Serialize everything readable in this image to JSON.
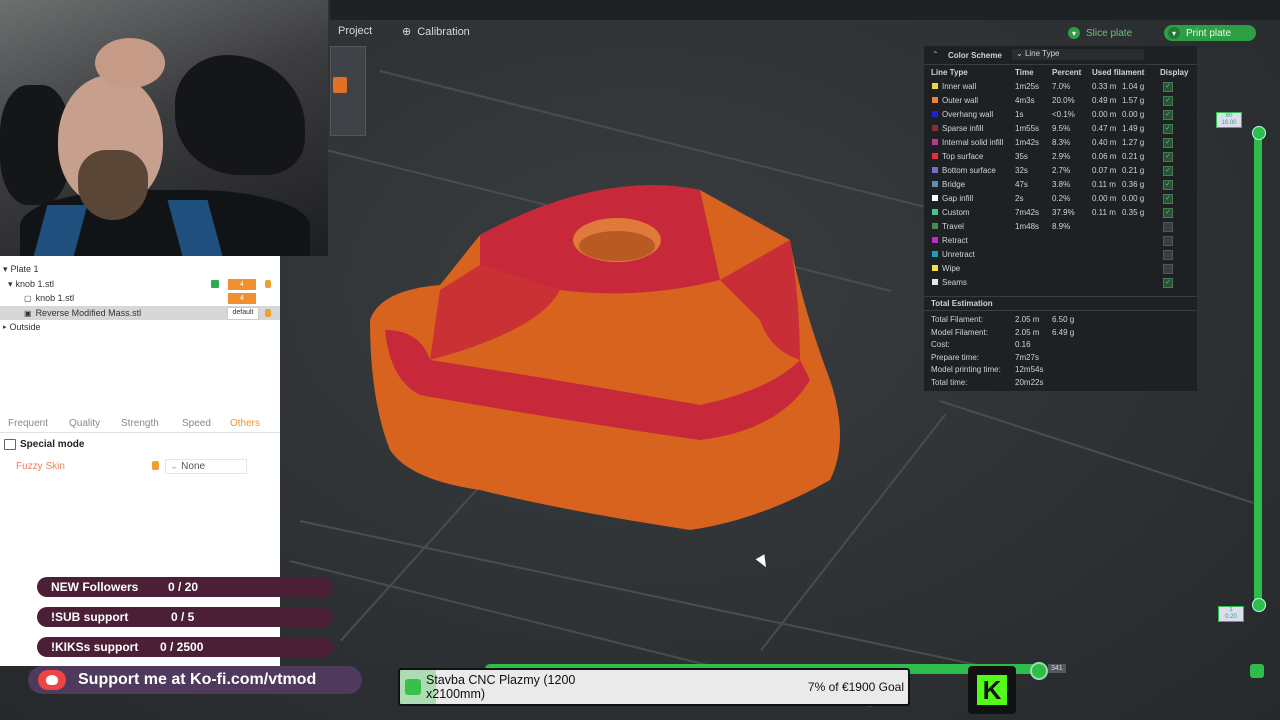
{
  "toolbar": {
    "project": "Project",
    "calibration": "Calibration",
    "slice_plate": "Slice plate",
    "print_plate": "Print plate"
  },
  "objects": {
    "plate": "Plate 1",
    "knob_group": "knob 1.stl",
    "knob_group_tag": "4",
    "knob_part": "knob 1.stl",
    "knob_part_tag": "4",
    "modifier": "Reverse Modified Mass.stl",
    "modifier_tag": "default",
    "outside": "Outside"
  },
  "settings": {
    "tabs": [
      "Frequent",
      "Quality",
      "Strength",
      "Speed",
      "Others"
    ],
    "active_tab": "Others",
    "section": "Special mode",
    "fuzzy_skin_label": "Fuzzy Skin",
    "fuzzy_skin_value": "None"
  },
  "legend": {
    "color_scheme_label": "Color Scheme",
    "color_scheme_value": "Line Type",
    "headers": [
      "Line Type",
      "Time",
      "Percent",
      "Used filament",
      "Display"
    ],
    "rows": [
      {
        "name": "Inner wall",
        "time": "1m25s",
        "percent": "7.0%",
        "len": "0.33 m",
        "weight": "1.04 g",
        "color": "#f0d23a",
        "display": true
      },
      {
        "name": "Outer wall",
        "time": "4m3s",
        "percent": "20.0%",
        "len": "0.49 m",
        "weight": "1.57 g",
        "color": "#f08030",
        "display": true
      },
      {
        "name": "Overhang wall",
        "time": "1s",
        "percent": "<0.1%",
        "len": "0.00 m",
        "weight": "0.00 g",
        "color": "#1f1fd6",
        "display": true
      },
      {
        "name": "Sparse infill",
        "time": "1m55s",
        "percent": "9.5%",
        "len": "0.47 m",
        "weight": "1.49 g",
        "color": "#8a2b3a",
        "display": true
      },
      {
        "name": "Internal solid infill",
        "time": "1m42s",
        "percent": "8.3%",
        "len": "0.40 m",
        "weight": "1.27 g",
        "color": "#b8388f",
        "display": true
      },
      {
        "name": "Top surface",
        "time": "35s",
        "percent": "2.9%",
        "len": "0.06 m",
        "weight": "0.21 g",
        "color": "#e0303a",
        "display": true
      },
      {
        "name": "Bottom surface",
        "time": "32s",
        "percent": "2.7%",
        "len": "0.07 m",
        "weight": "0.21 g",
        "color": "#7a6ad0",
        "display": true
      },
      {
        "name": "Bridge",
        "time": "47s",
        "percent": "3.8%",
        "len": "0.11 m",
        "weight": "0.36 g",
        "color": "#5a8fb0",
        "display": true
      },
      {
        "name": "Gap infill",
        "time": "2s",
        "percent": "0.2%",
        "len": "0.00 m",
        "weight": "0.00 g",
        "color": "#ffffff",
        "display": true
      },
      {
        "name": "Custom",
        "time": "7m42s",
        "percent": "37.9%",
        "len": "0.11 m",
        "weight": "0.35 g",
        "color": "#4ec08a",
        "display": true
      },
      {
        "name": "Travel",
        "time": "1m48s",
        "percent": "8.9%",
        "len": "",
        "weight": "",
        "color": "#4d8a4d",
        "display": false
      },
      {
        "name": "Retract",
        "time": "",
        "percent": "",
        "len": "",
        "weight": "",
        "color": "#c02bd0",
        "display": false
      },
      {
        "name": "Unretract",
        "time": "",
        "percent": "",
        "len": "",
        "weight": "",
        "color": "#1aa0b0",
        "display": false
      },
      {
        "name": "Wipe",
        "time": "",
        "percent": "",
        "len": "",
        "weight": "",
        "color": "#f0e040",
        "display": false
      },
      {
        "name": "Seams",
        "time": "",
        "percent": "",
        "len": "",
        "weight": "",
        "color": "#e8e8e8",
        "display": true
      }
    ],
    "estimation_title": "Total Estimation",
    "estimation": [
      {
        "label": "Total Filament:",
        "v1": "2.05 m",
        "v2": "6.50 g"
      },
      {
        "label": "Model Filament:",
        "v1": "2.05 m",
        "v2": "6.49 g"
      },
      {
        "label": "Cost:",
        "v1": "0.16",
        "v2": ""
      },
      {
        "label": "Prepare time:",
        "v1": "7m27s",
        "v2": ""
      },
      {
        "label": "Model printing time:",
        "v1": "12m54s",
        "v2": ""
      },
      {
        "label": "Total time:",
        "v1": "20m22s",
        "v2": ""
      }
    ]
  },
  "slider": {
    "top_label_a": "80",
    "top_label_b": "16.00",
    "bottom_label_a": "1",
    "bottom_label_b": "0.20",
    "horizontal_label": "341"
  },
  "stream": {
    "goals": [
      {
        "label": "NEW Followers",
        "count": "0 / 20"
      },
      {
        "label": "!SUB support",
        "count": "0 / 5"
      },
      {
        "label": "!KIKSs support",
        "count": "0 / 2500"
      }
    ],
    "kofi": "Support me at Ko-fi.com/vtmod",
    "donation_title": "Stavba CNC Plazmy (1200 x2100mm)",
    "donation_goal": "7% of €1900 Goal",
    "donation_progress": 0.07,
    "kick_letter": "K"
  }
}
